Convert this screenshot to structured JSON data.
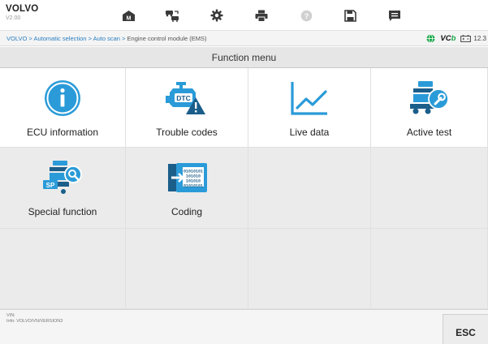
{
  "app": {
    "brand": "VOLVO",
    "version": "V2.00"
  },
  "toolbar": {
    "items": [
      {
        "name": "home-icon"
      },
      {
        "name": "vehicle-swap-icon"
      },
      {
        "name": "settings-gear-icon"
      },
      {
        "name": "print-icon"
      },
      {
        "name": "help-icon"
      },
      {
        "name": "save-icon"
      },
      {
        "name": "message-icon"
      }
    ]
  },
  "breadcrumb": {
    "path": [
      "VOLVO",
      "Automatic selection",
      "Auto scan"
    ],
    "separator": " > ",
    "current": "Engine control module (EMS)"
  },
  "status": {
    "vcb_prefix": "VC",
    "vcb_suffix": "b",
    "voltage": "12.3"
  },
  "menu": {
    "title": "Function menu",
    "items": [
      {
        "label": "ECU information",
        "icon": "info-circle-icon"
      },
      {
        "label": "Trouble codes",
        "icon": "engine-dtc-warning-icon"
      },
      {
        "label": "Live data",
        "icon": "line-graph-icon"
      },
      {
        "label": "Active test",
        "icon": "truck-wrench-icon"
      },
      {
        "label": "Special function",
        "icon": "truck-sp-search-icon"
      },
      {
        "label": "Coding",
        "icon": "binary-coding-icon"
      }
    ]
  },
  "footer": {
    "vin_label": "VIN:",
    "info": "Info: VOLVO/VN/VERSION3",
    "esc_label": "ESC"
  },
  "colors": {
    "accent_blue": "#2a9bd8",
    "link_blue": "#2a7fc1",
    "vcb_green": "#1aa84a",
    "warning_dark": "#1b5e8a"
  }
}
